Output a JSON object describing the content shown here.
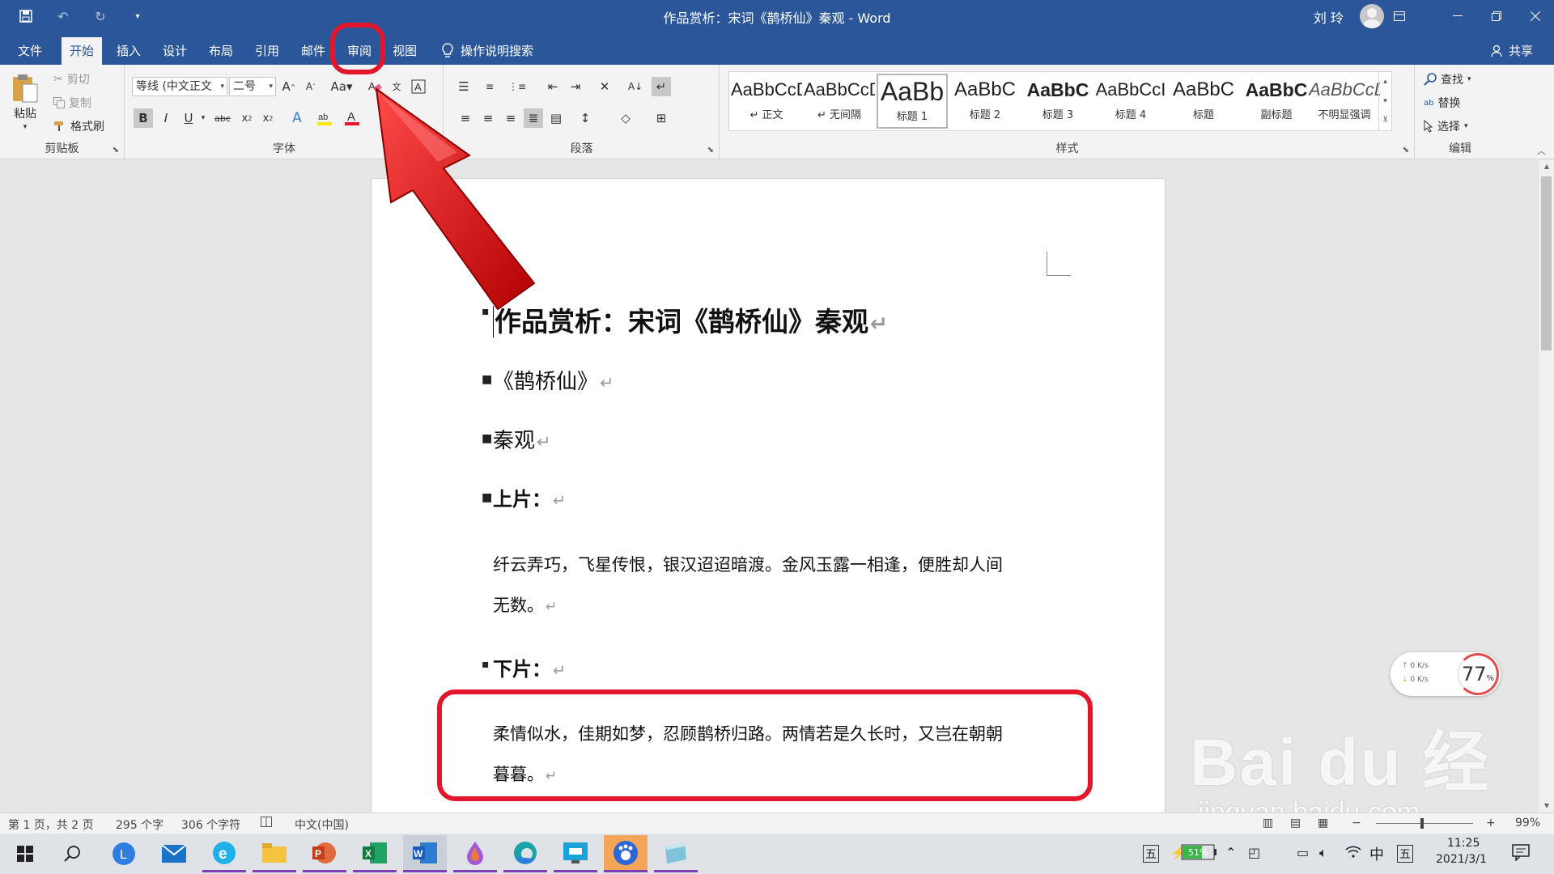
{
  "titlebar": {
    "title": "作品赏析：宋词《鹊桥仙》秦观  -  Word",
    "user": "刘 玲"
  },
  "tabs": [
    "文件",
    "开始",
    "插入",
    "设计",
    "布局",
    "引用",
    "邮件",
    "审阅",
    "视图"
  ],
  "active_tab": "开始",
  "search_label": "操作说明搜索",
  "share_label": "共享",
  "clipboard": {
    "paste": "粘贴",
    "cut": "剪切",
    "copy": "复制",
    "format_painter": "格式刷",
    "group": "剪贴板"
  },
  "font": {
    "name": "等线 (中文正文",
    "size": "二号",
    "group": "字体"
  },
  "paragraph": {
    "group": "段落"
  },
  "styles": {
    "group": "样式",
    "items": [
      {
        "preview": "AaBbCcDd",
        "name": "↵ 正文"
      },
      {
        "preview": "AaBbCcDd",
        "name": "↵ 无间隔"
      },
      {
        "preview": "AaBb",
        "name": "标题 1"
      },
      {
        "preview": "AaBbC",
        "name": "标题 2"
      },
      {
        "preview": "AaBbC",
        "name": "标题 3"
      },
      {
        "preview": "AaBbCcI",
        "name": "标题 4"
      },
      {
        "preview": "AaBbC",
        "name": "标题"
      },
      {
        "preview": "AaBbC",
        "name": "副标题"
      },
      {
        "preview": "AaBbCcDd",
        "name": "不明显强调"
      }
    ]
  },
  "editing": {
    "find": "查找",
    "replace": "替换",
    "select": "选择",
    "group": "编辑"
  },
  "document": {
    "title": "作品赏析：宋词《鹊桥仙》秦观",
    "poem": "《鹊桥仙》",
    "author": "秦观",
    "part1_label": "上片：",
    "part1_line1": "纤云弄巧，飞星传恨，银汉迢迢暗渡。金风玉露一相逢，便胜却人间",
    "part1_line2": "无数。",
    "part2_label": "下片：",
    "part2_line1": "柔情似水，佳期如梦，忍顾鹊桥归路。两情若是久长时，又岂在朝朝",
    "part2_line2": "暮暮。",
    "para_mark": "↵"
  },
  "speed_widget": {
    "up": "0  K/s",
    "down": "0  K/s",
    "percent": "77",
    "percent_unit": "%"
  },
  "watermark": {
    "logo": "Bai du 经验",
    "url": "jingyan.baidu.com"
  },
  "statusbar": {
    "page": "第 1 页，共 2 页",
    "words": "295 个字",
    "chars": "306 个字符",
    "lang": "中文(中国)",
    "zoom": "99%"
  },
  "taskbar": {
    "battery": "51%",
    "ime1": "五",
    "ime_lang": "中",
    "ime2": "五",
    "time": "11:25",
    "date": "2021/3/1"
  },
  "colors": {
    "word_blue": "#2b579a",
    "highlight_red": "#e3162c"
  }
}
